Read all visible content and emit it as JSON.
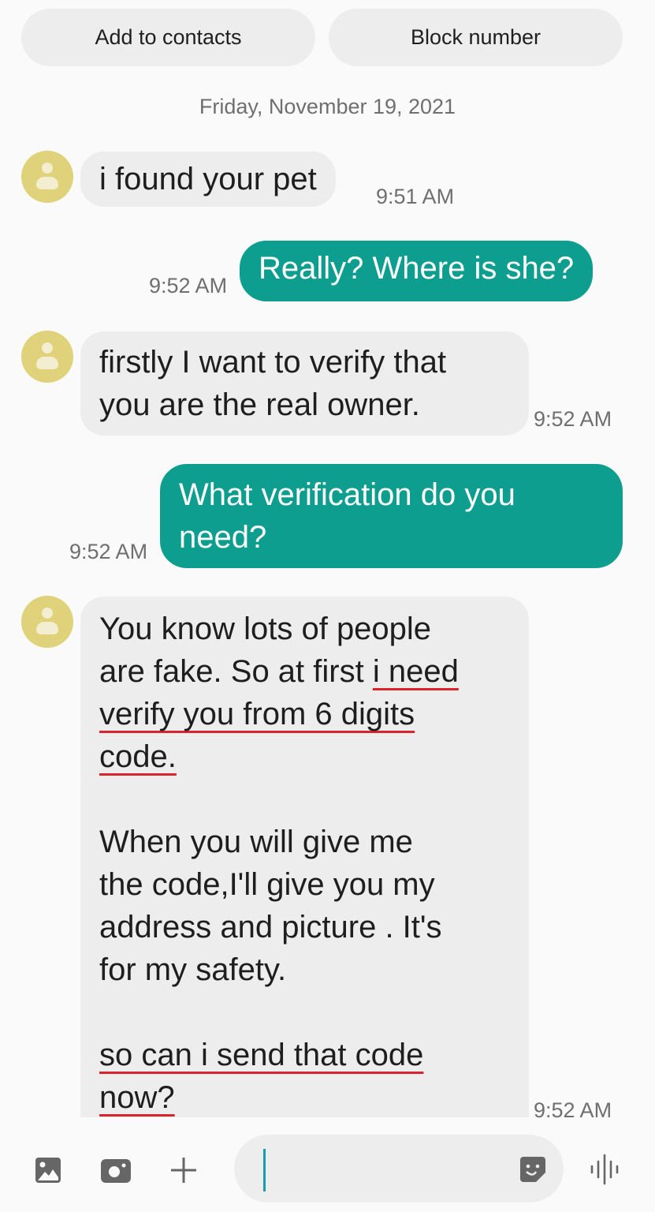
{
  "actions": {
    "add_to_contacts": "Add to contacts",
    "block_number": "Block number"
  },
  "date_separator": "Friday, November 19, 2021",
  "messages": [
    {
      "direction": "incoming",
      "text": "i found your pet",
      "time": "9:51 AM"
    },
    {
      "direction": "outgoing",
      "text": "Really? Where is she?",
      "time": "9:52 AM"
    },
    {
      "direction": "incoming",
      "lines": [
        "firstly I want to verify that",
        "you are the real owner."
      ],
      "time": "9:52 AM"
    },
    {
      "direction": "outgoing",
      "lines": [
        "What verification do you",
        "need?"
      ],
      "time": "9:52 AM"
    },
    {
      "direction": "incoming",
      "time": "9:52 AM",
      "p1": {
        "l1": "You know lots of people",
        "l2a": "are fake. So at first ",
        "l2b": "i need",
        "l3": "verify you from 6 digits",
        "l4": "code."
      },
      "p2": [
        "When you will give me",
        "the code,I'll give you my",
        "address and picture . It's",
        "for my safety."
      ],
      "p3": {
        "l1": "so can i send that code",
        "l2": "now?"
      },
      "annotation_color": "#d9232e"
    }
  ],
  "composer": {
    "input_value": "",
    "icons": [
      "gallery-icon",
      "camera-icon",
      "plus-icon",
      "sticker-icon",
      "voice-icon"
    ]
  },
  "colors": {
    "outgoing_bubble": "#0e9e8f",
    "incoming_bubble": "#ededed",
    "avatar": "#dfd27a"
  }
}
